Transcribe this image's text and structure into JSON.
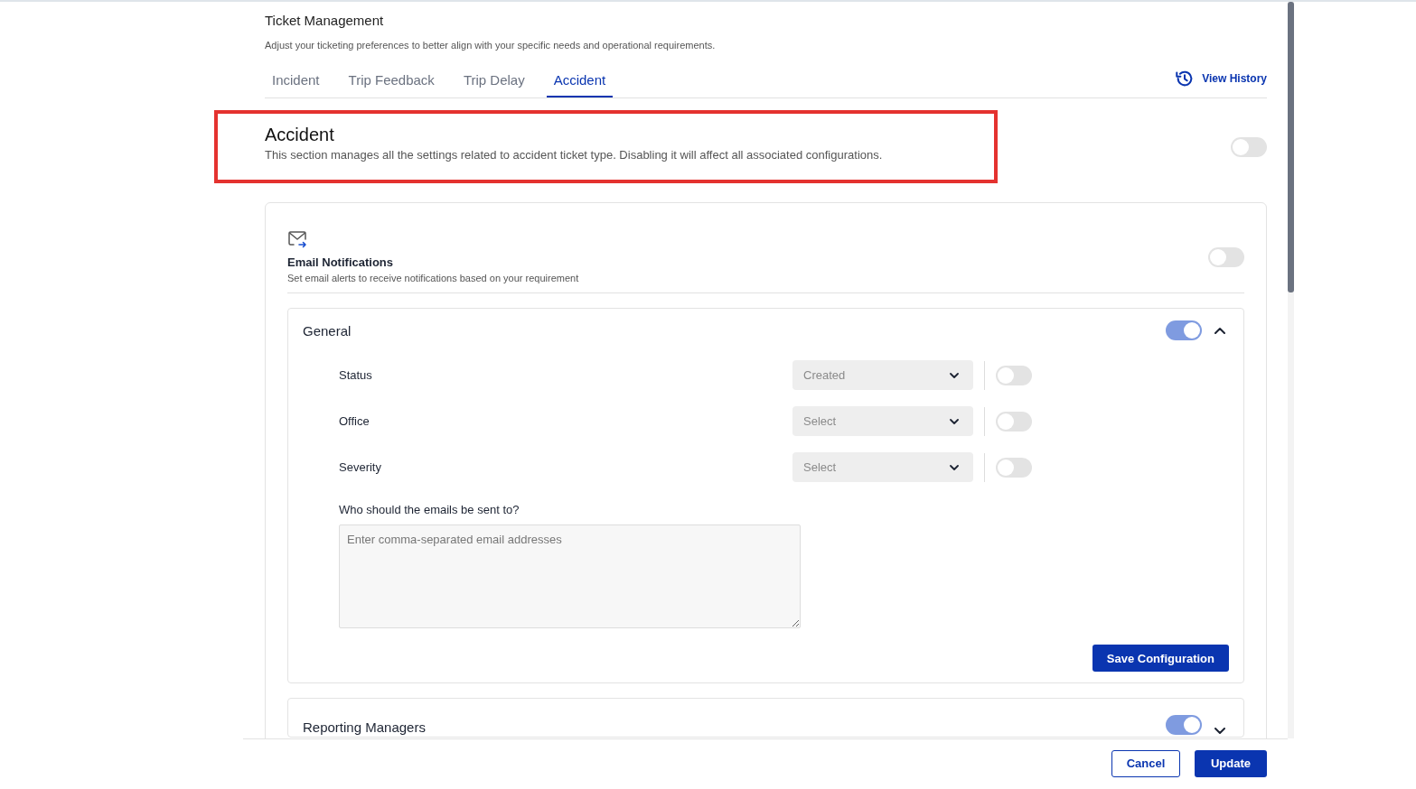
{
  "header": {
    "title": "Ticket Management",
    "subtitle": "Adjust your ticketing preferences to better align with your specific needs and operational requirements."
  },
  "tabs": [
    {
      "label": "Incident",
      "selected": false
    },
    {
      "label": "Trip Feedback",
      "selected": false
    },
    {
      "label": "Trip Delay",
      "selected": false
    },
    {
      "label": "Accident",
      "selected": true
    }
  ],
  "view_history": {
    "label": "View History"
  },
  "section": {
    "title": "Accident",
    "description": "This section manages all the settings related to accident ticket type. Disabling it will affect all associated configurations.",
    "enabled": false,
    "highlighted": true
  },
  "email_notifications": {
    "title": "Email Notifications",
    "description": "Set email alerts to receive notifications based on your requirement",
    "enabled": false
  },
  "groups": [
    {
      "title": "General",
      "enabled": true,
      "expanded": true,
      "fields": [
        {
          "label": "Status",
          "value": "Created",
          "enabled": false
        },
        {
          "label": "Office",
          "placeholder": "Select",
          "enabled": false
        },
        {
          "label": "Severity",
          "placeholder": "Select",
          "enabled": false
        }
      ],
      "recipients": {
        "label": "Who should the emails be sent to?",
        "placeholder": "Enter comma-separated email addresses"
      },
      "save_button": "Save Configuration"
    },
    {
      "title": "Reporting Managers",
      "enabled": true,
      "expanded": false
    }
  ],
  "footer": {
    "cancel": "Cancel",
    "update": "Update"
  }
}
